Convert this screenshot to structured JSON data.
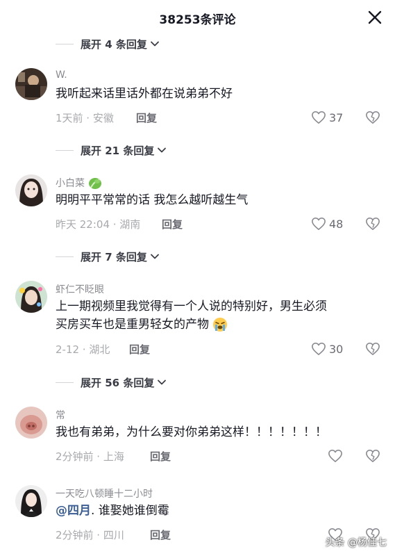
{
  "header": {
    "title": "38253条评论",
    "close_icon": "close-icon"
  },
  "expanders": [
    {
      "label": "展开 4 条回复"
    },
    {
      "label": "展开 21 条回复"
    },
    {
      "label": "展开 7 条回复"
    },
    {
      "label": "展开 56 条回复"
    }
  ],
  "comments": [
    {
      "username": "W.",
      "text": "我听起来话里话外都在说弟弟不好",
      "meta": "1天前 · 安徽",
      "reply": "回复",
      "likes": "37"
    },
    {
      "username": "小白菜",
      "username_emoji": "cabbage-icon",
      "text": "明明平平常常的话 我怎么越听越生气",
      "meta": "昨天 22:04 · 湖南",
      "reply": "回复",
      "likes": "48"
    },
    {
      "username": "虾仁不眨眼",
      "text_line1": "上一期视频里我觉得有一个人说的特别好，男生必须",
      "text_line2": "买房买车也是重男轻女的产物",
      "text_emoji": "crying-face-icon",
      "meta": "2-12 · 湖北",
      "reply": "回复",
      "likes": "30"
    },
    {
      "username": "常",
      "text": "我也有弟弟，为什么要对你弟弟这样！！！！！！！",
      "meta": "2分钟前 · 上海",
      "reply": "回复",
      "likes": ""
    },
    {
      "username": "一天吃八顿睡十二小时",
      "mention": "@四月",
      "text": ". 谁娶她谁倒霉",
      "meta": "2分钟前 · 四川",
      "reply": "回复",
      "likes": ""
    }
  ],
  "watermark": "头条 @杨佳七",
  "colors": {
    "text_primary": "#161823",
    "text_secondary": "#a8a9ad",
    "mention": "#3b5e95"
  }
}
